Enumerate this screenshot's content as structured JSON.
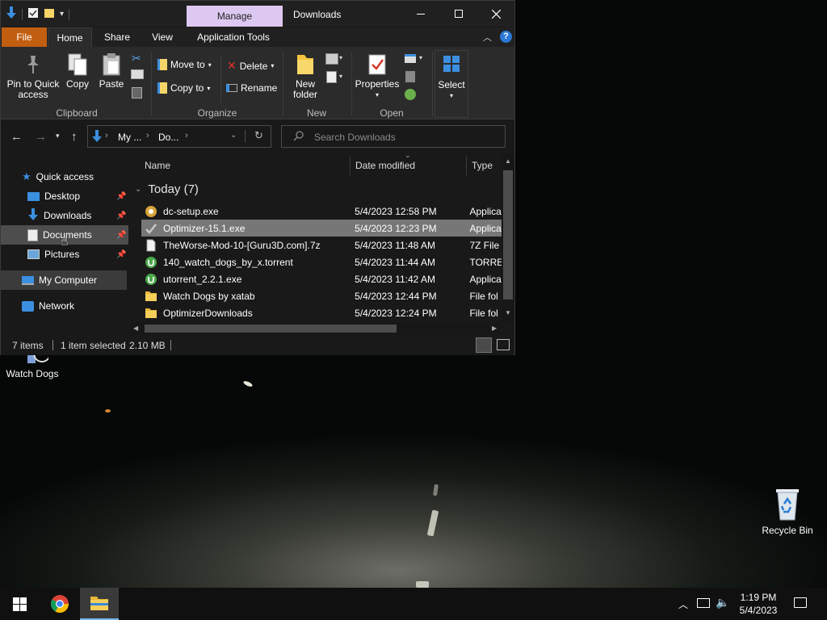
{
  "window": {
    "title": "Downloads",
    "manage_tab": "Manage",
    "tabs": [
      "File",
      "Home",
      "Share",
      "View",
      "Application Tools"
    ]
  },
  "ribbon": {
    "clipboard": {
      "pin": "Pin to Quick access",
      "copy": "Copy",
      "paste": "Paste",
      "label": "Clipboard"
    },
    "organize": {
      "move_to": "Move to",
      "copy_to": "Copy to",
      "delete": "Delete",
      "rename": "Rename",
      "label": "Organize"
    },
    "new": {
      "new_folder": "New folder",
      "label": "New"
    },
    "open": {
      "properties": "Properties",
      "label": "Open"
    },
    "select": {
      "select": "Select"
    }
  },
  "address": {
    "crumbs": [
      "My ...",
      "Do..."
    ],
    "search_placeholder": "Search Downloads"
  },
  "nav": {
    "quick_access": "Quick access",
    "items": [
      {
        "label": "Desktop",
        "icon": "desktop-icon"
      },
      {
        "label": "Downloads",
        "icon": "download-icon"
      },
      {
        "label": "Documents",
        "icon": "documents-icon"
      },
      {
        "label": "Pictures",
        "icon": "pictures-icon"
      }
    ],
    "my_computer": "My Computer",
    "network": "Network"
  },
  "list": {
    "columns": [
      "Name",
      "Date modified",
      "Type"
    ],
    "group": "Today (7)",
    "rows": [
      {
        "name": "dc-setup.exe",
        "date": "5/4/2023 12:58 PM",
        "type": "Applica",
        "icon": "installer-icon"
      },
      {
        "name": "Optimizer-15.1.exe",
        "date": "5/4/2023 12:23 PM",
        "type": "Applica",
        "icon": "checkmark-app-icon"
      },
      {
        "name": "TheWorse-Mod-10-[Guru3D.com].7z",
        "date": "5/4/2023 11:48 AM",
        "type": "7Z File",
        "icon": "file-icon"
      },
      {
        "name": "140_watch_dogs_by_x.torrent",
        "date": "5/4/2023 11:44 AM",
        "type": "TORREN",
        "icon": "utorrent-icon"
      },
      {
        "name": "utorrent_2.2.1.exe",
        "date": "5/4/2023 11:42 AM",
        "type": "Applica",
        "icon": "utorrent-icon"
      },
      {
        "name": "Watch Dogs by xatab",
        "date": "5/4/2023 12:44 PM",
        "type": "File fol",
        "icon": "folder-icon"
      },
      {
        "name": "OptimizerDownloads",
        "date": "5/4/2023 12:24 PM",
        "type": "File fol",
        "icon": "folder-icon"
      }
    ]
  },
  "status": {
    "count": "7 items",
    "selected": "1 item selected",
    "size": "2.10 MB"
  },
  "desktop": {
    "watch_dogs": "Watch Dogs",
    "recycle_bin": "Recycle Bin"
  },
  "taskbar": {
    "time": "1:19 PM",
    "date": "5/4/2023"
  }
}
